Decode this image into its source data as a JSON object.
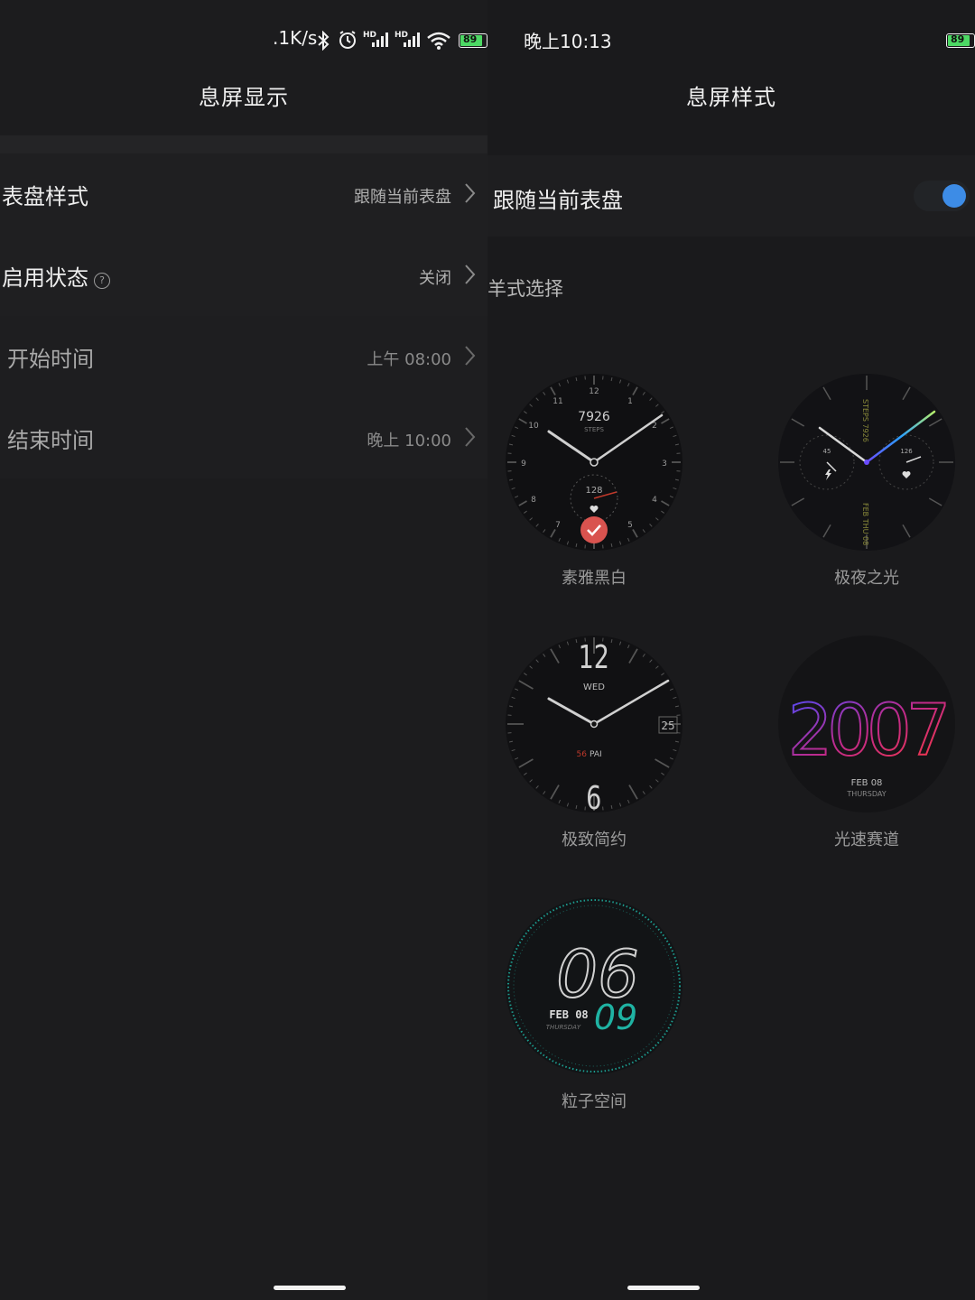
{
  "status_bar": {
    "net_speed": ".1K/s",
    "hd1": "HD",
    "hd2": "HD",
    "battery_left": "89",
    "time": "晚上10:13",
    "battery_right": "89"
  },
  "left_screen": {
    "title": "息屏显示",
    "rows": [
      {
        "label": "表盘样式",
        "value": "跟随当前表盘"
      },
      {
        "label": "启用状态",
        "value": "关闭",
        "help": "?"
      },
      {
        "label": "开始时间",
        "value": "上午 08:00"
      },
      {
        "label": "结束时间",
        "value": "晚上 10:00"
      }
    ]
  },
  "right_screen": {
    "title": "息屏样式",
    "follow_toggle": {
      "label": "跟随当前表盘",
      "on": true
    },
    "section_title": "羊式选择",
    "faces": [
      {
        "name": "素雅黑白",
        "selected": true,
        "steps": "7926",
        "steps_label": "STEPS",
        "heart": "128",
        "nums": [
          "12",
          "1",
          "2",
          "3",
          "4",
          "5",
          "6",
          "7",
          "8",
          "9",
          "10",
          "11"
        ]
      },
      {
        "name": "极夜之光",
        "selected": false,
        "left_dial": "45",
        "right_dial": "126",
        "top_text": "STEPS 7926",
        "bottom_text": "FEB THU 08"
      },
      {
        "name": "极致简约",
        "selected": false,
        "top": "12",
        "bottom": "6",
        "day": "WED",
        "date": "25",
        "pai_value": "56",
        "pai_label": "PAI"
      },
      {
        "name": "光速赛道",
        "selected": false,
        "year": "2007",
        "date": "FEB 08",
        "weekday": "THURSDAY"
      },
      {
        "name": "粒子空间",
        "selected": false,
        "hour": "06",
        "minute": "09",
        "date": "FEB 08",
        "weekday": "THURSDAY"
      }
    ]
  },
  "colors": {
    "accent": "#3d8ce6",
    "selected_badge": "#d9534f",
    "teal": "#1fb3a3"
  }
}
